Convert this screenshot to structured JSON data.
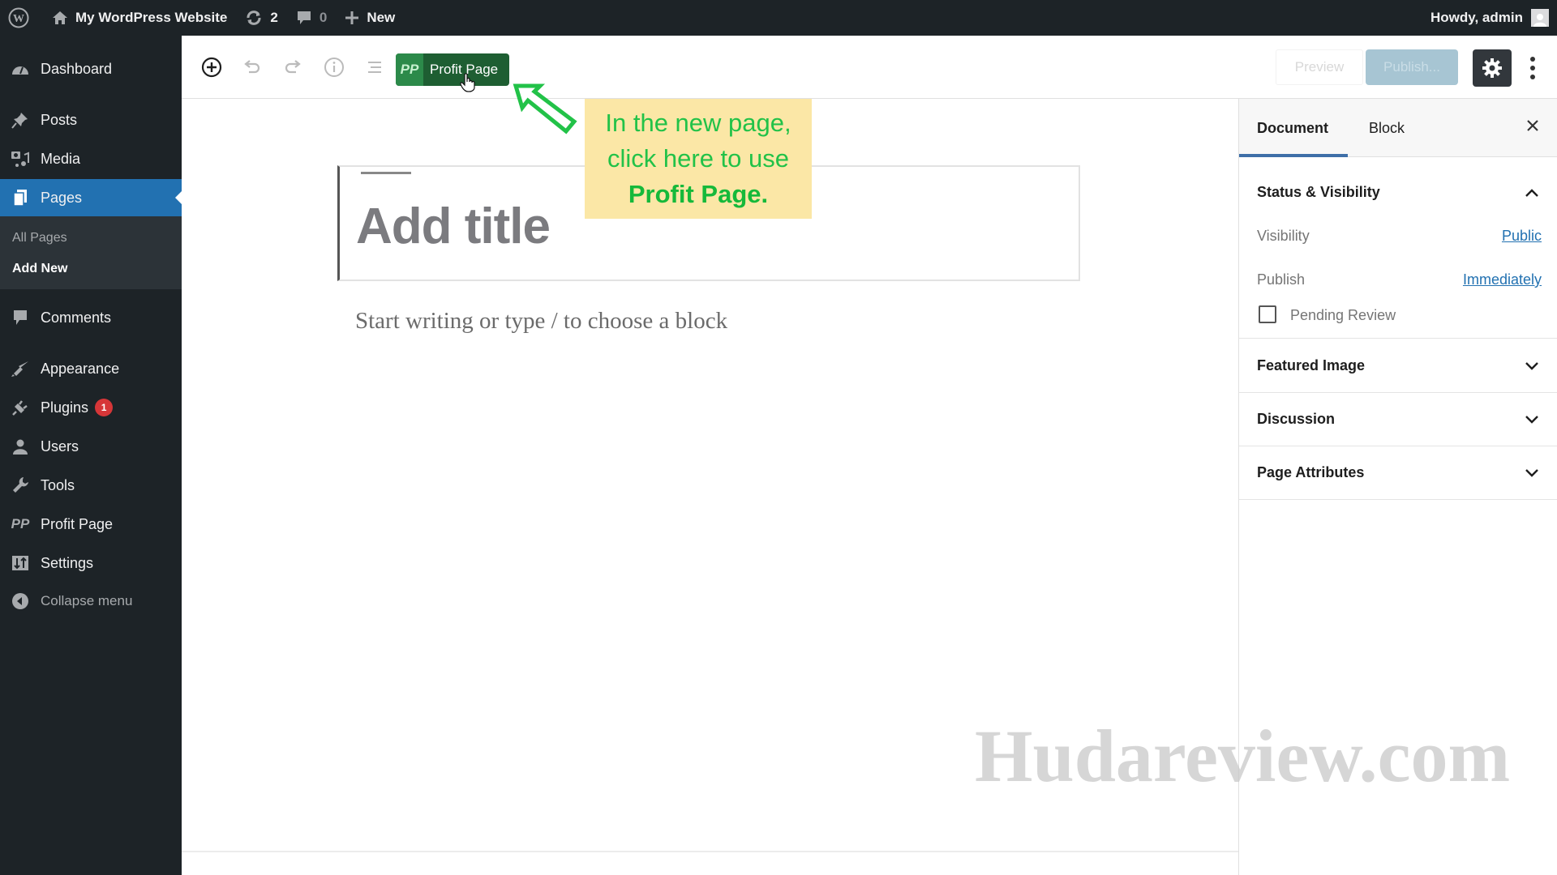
{
  "admin_bar": {
    "site_name": "My WordPress Website",
    "updates_count": "2",
    "comments_count": "0",
    "new_label": "New",
    "greeting": "Howdy, admin"
  },
  "sidebar": {
    "items": [
      {
        "label": "Dashboard",
        "icon": "dashboard-icon"
      },
      {
        "label": "Posts",
        "icon": "pin-icon"
      },
      {
        "label": "Media",
        "icon": "media-icon"
      },
      {
        "label": "Pages",
        "icon": "pages-icon",
        "active": true
      },
      {
        "label": "Comments",
        "icon": "comment-icon"
      },
      {
        "label": "Appearance",
        "icon": "brush-icon"
      },
      {
        "label": "Plugins",
        "icon": "plugin-icon",
        "badge": "1"
      },
      {
        "label": "Users",
        "icon": "user-icon"
      },
      {
        "label": "Tools",
        "icon": "wrench-icon"
      },
      {
        "label": "Profit Page",
        "icon": "profit-page-icon"
      },
      {
        "label": "Settings",
        "icon": "settings-icon"
      }
    ],
    "submenu": [
      {
        "label": "All Pages"
      },
      {
        "label": "Add New",
        "current": true
      }
    ],
    "collapse_label": "Collapse menu"
  },
  "toolbar": {
    "profit_page_label": "Profit Page",
    "profit_page_logo": "PP",
    "preview_label": "Preview",
    "publish_label": "Publish..."
  },
  "editor": {
    "title_placeholder": "Add title",
    "body_placeholder": "Start writing or type / to choose a block"
  },
  "annotation": {
    "line1": "In the new page,",
    "line2": "click here to use",
    "line3": "Profit Page.",
    "text_color": "#22c248",
    "bg_color": "#fbe7a6"
  },
  "panel": {
    "tabs": [
      {
        "label": "Document",
        "active": true
      },
      {
        "label": "Block"
      }
    ],
    "status_visibility": {
      "title": "Status & Visibility",
      "visibility_label": "Visibility",
      "visibility_value": "Public",
      "publish_label": "Publish",
      "publish_value": "Immediately",
      "pending_review_label": "Pending Review",
      "pending_review_checked": false
    },
    "sections": [
      {
        "title": "Featured Image"
      },
      {
        "title": "Discussion"
      },
      {
        "title": "Page Attributes"
      }
    ]
  },
  "watermark": "Hudareview.com",
  "colors": {
    "admin_dark": "#1d2327",
    "accent_blue": "#2271b1",
    "profit_green": "#1e5e32",
    "badge_red": "#d63638"
  }
}
